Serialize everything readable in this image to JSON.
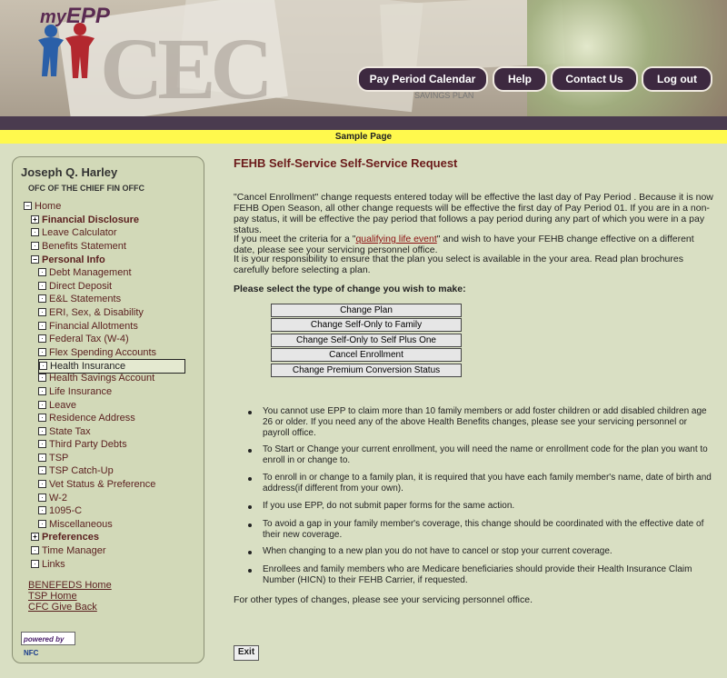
{
  "header": {
    "logo_text_prefix": "my",
    "logo_text_main": "EPP",
    "bg_text": "CEC",
    "bg_plan_text": "SAVINGS PLAN",
    "nav": [
      {
        "label": "Pay Period Calendar"
      },
      {
        "label": "Help"
      },
      {
        "label": "Contact Us"
      },
      {
        "label": "Log out"
      }
    ]
  },
  "banner": {
    "text": "Sample Page"
  },
  "sidebar": {
    "user_name": "Joseph Q. Harley",
    "office": "OFC OF THE CHIEF FIN OFFC",
    "tree": [
      {
        "label": "Home",
        "box": "−"
      },
      {
        "label": "Financial Disclosure",
        "box": "+"
      },
      {
        "label": "Leave Calculator",
        "box": "·"
      },
      {
        "label": "Benefits Statement",
        "box": "·"
      },
      {
        "label": "Personal Info",
        "box": "−"
      },
      {
        "label": "Debt Management",
        "box": "·"
      },
      {
        "label": "Direct Deposit",
        "box": "·"
      },
      {
        "label": "E&L Statements",
        "box": "·"
      },
      {
        "label": "ERI, Sex, & Disability",
        "box": "·"
      },
      {
        "label": "Financial Allotments",
        "box": "·"
      },
      {
        "label": "Federal Tax (W-4)",
        "box": "·"
      },
      {
        "label": "Flex Spending Accounts",
        "box": "·"
      },
      {
        "label": "Health Insurance",
        "box": "·"
      },
      {
        "label": "Health Savings Account",
        "box": "·"
      },
      {
        "label": "Life Insurance",
        "box": "·"
      },
      {
        "label": "Leave",
        "box": "·"
      },
      {
        "label": "Residence Address",
        "box": "·"
      },
      {
        "label": "State Tax",
        "box": "·"
      },
      {
        "label": "Third Party Debts",
        "box": "·"
      },
      {
        "label": "TSP",
        "box": "·"
      },
      {
        "label": "TSP Catch-Up",
        "box": "·"
      },
      {
        "label": "Vet Status & Preference",
        "box": "·"
      },
      {
        "label": "W-2",
        "box": "·"
      },
      {
        "label": "1095-C",
        "box": "·"
      },
      {
        "label": "Miscellaneous",
        "box": "·"
      },
      {
        "label": "Preferences",
        "box": "+"
      },
      {
        "label": "Time Manager",
        "box": "·"
      },
      {
        "label": "Links",
        "box": "·"
      }
    ],
    "links": [
      {
        "label": "BENEFEDS Home"
      },
      {
        "label": "TSP Home"
      },
      {
        "label": "CFC Give Back"
      }
    ],
    "powered_by": "powered by",
    "powered_logo": "NFC"
  },
  "main": {
    "title": "FEHB Self-Service Self-Service Request",
    "para1": "\"Cancel Enrollment\" change requests entered today will be effective the last day of Pay Period . Because it is now FEHB Open Season, all other change requests will be effective the first day of Pay Period 01. If you are in a non-pay status, it will be effective the pay period that follows a pay period during any part of which you were in a pay status.",
    "para2_prefix": "If you meet the criteria for a \"",
    "para2_link": "qualifying life event",
    "para2_suffix": "\" and wish to have your FEHB change effective on a different date, please see your servicing personnel office.",
    "para3": "It is your responsibility to ensure that the plan you select is available in the your area. Read plan brochures carefully before selecting a plan.",
    "select_label": "Please select the type of change you wish to make:",
    "choices": [
      {
        "label": "Change Plan"
      },
      {
        "label": "Change Self-Only to Family"
      },
      {
        "label": "Change Self-Only to Self Plus One"
      },
      {
        "label": "Cancel Enrollment"
      },
      {
        "label": "Change Premium Conversion Status"
      }
    ],
    "bullets": [
      {
        "text": "You cannot use EPP to claim more than 10 family members or add foster children or add disabled children age 26 or older. If you need any of the above Health Benefits changes, please see your servicing personnel or payroll office."
      },
      {
        "text": "To Start or Change your current enrollment, you will need the name or enrollment code for the plan you want to enroll in or change to."
      },
      {
        "text": "To enroll in or change to a family plan, it is required that you have each family member's name, date of birth and address(if different from your own)."
      },
      {
        "text": "If you use EPP, do not submit paper forms for the same action."
      },
      {
        "text": "To avoid a gap in your family member's coverage, this change should be coordinated with the effective date of their new coverage."
      },
      {
        "text": "When changing to a new plan you do not have to cancel or stop your current coverage."
      },
      {
        "text": "Enrollees and family members who are Medicare beneficiaries should provide their Health Insurance Claim Number (HICN) to their FEHB Carrier, if requested."
      }
    ],
    "footer_text": "For other types of changes, please see your servicing personnel office.",
    "exit_label": "Exit"
  },
  "colors": {
    "nav_button": "#3d2940",
    "dark_bar": "#4a3b4f",
    "yellow_bar": "#fff94d",
    "page_bg": "#d9dfc3",
    "sidebar_bg": "#d2d9b8",
    "link": "#5a1f1f",
    "title": "#6b1a1a"
  }
}
